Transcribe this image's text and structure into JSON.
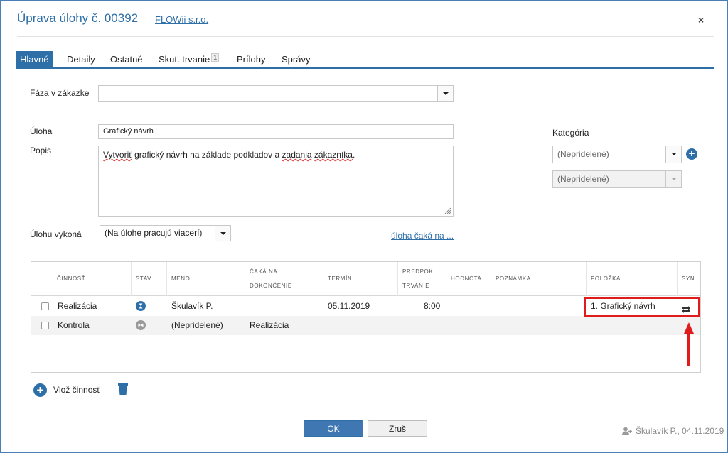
{
  "header": {
    "title": "Úprava úlohy č. 00392",
    "company": "FLOWii s.r.o.",
    "close": "×"
  },
  "tabs": [
    {
      "label": "Hlavné",
      "active": true
    },
    {
      "label": "Detaily"
    },
    {
      "label": "Ostatné"
    },
    {
      "label": "Skut. trvanie",
      "badge": "1"
    },
    {
      "label": "Prílohy"
    },
    {
      "label": "Správy"
    }
  ],
  "form": {
    "phase_label": "Fáza v zákazke",
    "phase_value": "",
    "task_label": "Úloha",
    "task_value": "Grafický návrh",
    "desc_label": "Popis",
    "desc_value": {
      "w1": "Vytvoriť",
      "w2": " grafický návrh na základe podkladov a ",
      "w3": "zadania",
      "w4": " ",
      "w5": "zákazníka",
      "w6": "."
    },
    "performer_label": "Úlohu vykoná",
    "performer_value": "(Na úlohe pracujú viacerí)",
    "waiting_link": "úloha čaká na ...",
    "category_label": "Kategória",
    "category_value": "(Nepridelené)",
    "subcategory_value": "(Nepridelené)"
  },
  "table": {
    "headers": {
      "activity": "Činnosť",
      "status": "Stav",
      "name": "Meno",
      "waits1": "Čaká na",
      "waits2": "dokončenie",
      "deadline": "Termín",
      "planned1": "Predpokl.",
      "planned2": "trvanie",
      "value": "Hodnota",
      "note": "Poznámka",
      "item": "Položka",
      "sync": "Syn"
    },
    "rows": [
      {
        "activity": "Realizácia",
        "name": "Škulavík P.",
        "waits": "",
        "deadline": "05.11.2019",
        "planned": "8:00",
        "value": "",
        "note": "",
        "item": "1. Grafický návrh",
        "status_color": "#2e6fa8"
      },
      {
        "activity": "Kontrola",
        "name": "(Nepridelené)",
        "waits": "Realizácia",
        "deadline": "",
        "planned": "",
        "value": "",
        "note": "",
        "item": "",
        "status_color": "#9a9a9a"
      }
    ]
  },
  "actions": {
    "add_activity": "Vlož činnosť",
    "ok": "OK",
    "cancel": "Zruš"
  },
  "footer": {
    "user_stamp": "Škulavík P., 04.11.2019"
  },
  "colors": {
    "accent": "#2e6fa8",
    "highlight": "#e01b1b"
  }
}
